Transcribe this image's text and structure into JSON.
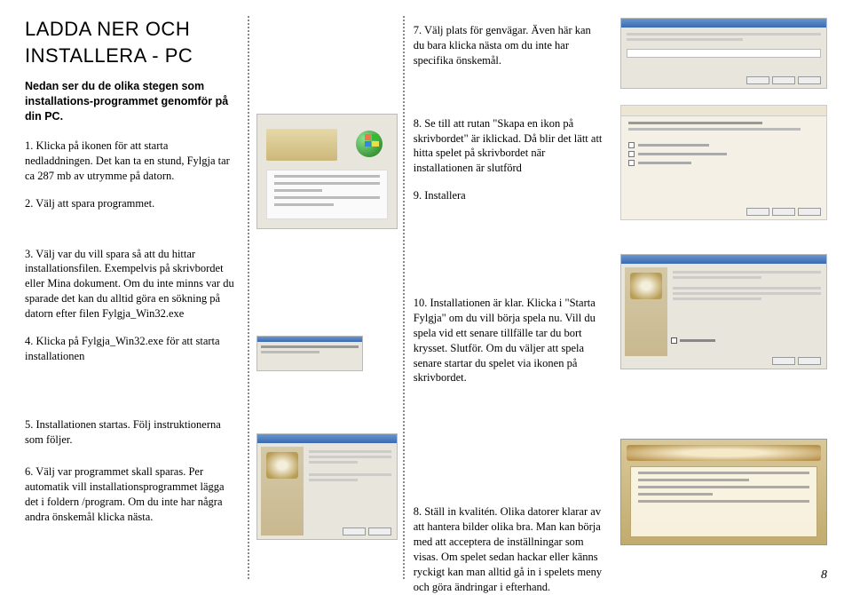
{
  "title": "LADDA NER OCH INSTALLERA - PC",
  "intro": "Nedan ser du de olika stegen som installations-programmet genomför på din PC.",
  "left": {
    "s1": "1. Klicka på ikonen för att starta nedladdningen. Det kan ta en stund, Fylgja tar ca 287 mb av utrymme på datorn.",
    "s2": "2. Välj att spara programmet.",
    "s3": "3. Välj var du vill spara så att du hittar installationsfilen. Exempelvis på skrivbordet eller Mina dokument. Om du inte minns var du sparade det kan du alltid göra en sökning på datorn efter filen Fylgja_Win32.exe",
    "s4": "4. Klicka på Fylgja_Win32.exe för att starta installationen",
    "s5": "5. Installationen startas. Följ instruktionerna som följer.",
    "s6": "6. Välj var programmet skall sparas. Per automatik vill installationsprogrammet lägga det i foldern /program. Om du inte har några andra önskemål klicka nästa."
  },
  "mid": {
    "s7": "7. Välj plats för genvägar. Även här kan du bara klicka nästa om du inte har specifika önskemål.",
    "s8a": "8. Se till att rutan \"Skapa en ikon på skrivbordet\" är iklickad. Då blir det lätt att hitta spelet på skrivbordet när installationen är slutförd",
    "s9": "9. Installera",
    "s10": "10. Installationen är klar. Klicka i \"Starta Fylgja\" om du vill börja spela nu. Vill du spela vid ett senare tillfälle tar du bort krysset. Slutför. Om du väljer att spela senare startar du spelet via ikonen på skrivbordet.",
    "s8b": "8. Ställ in kvalitén. Olika datorer klarar av att hantera bilder olika bra. Man kan börja med att acceptera de inställningar som visas. Om spelet sedan hackar eller känns ryckigt kan man alltid gå in i spelets meny och göra ändringar i efterhand."
  },
  "page_number": "8"
}
